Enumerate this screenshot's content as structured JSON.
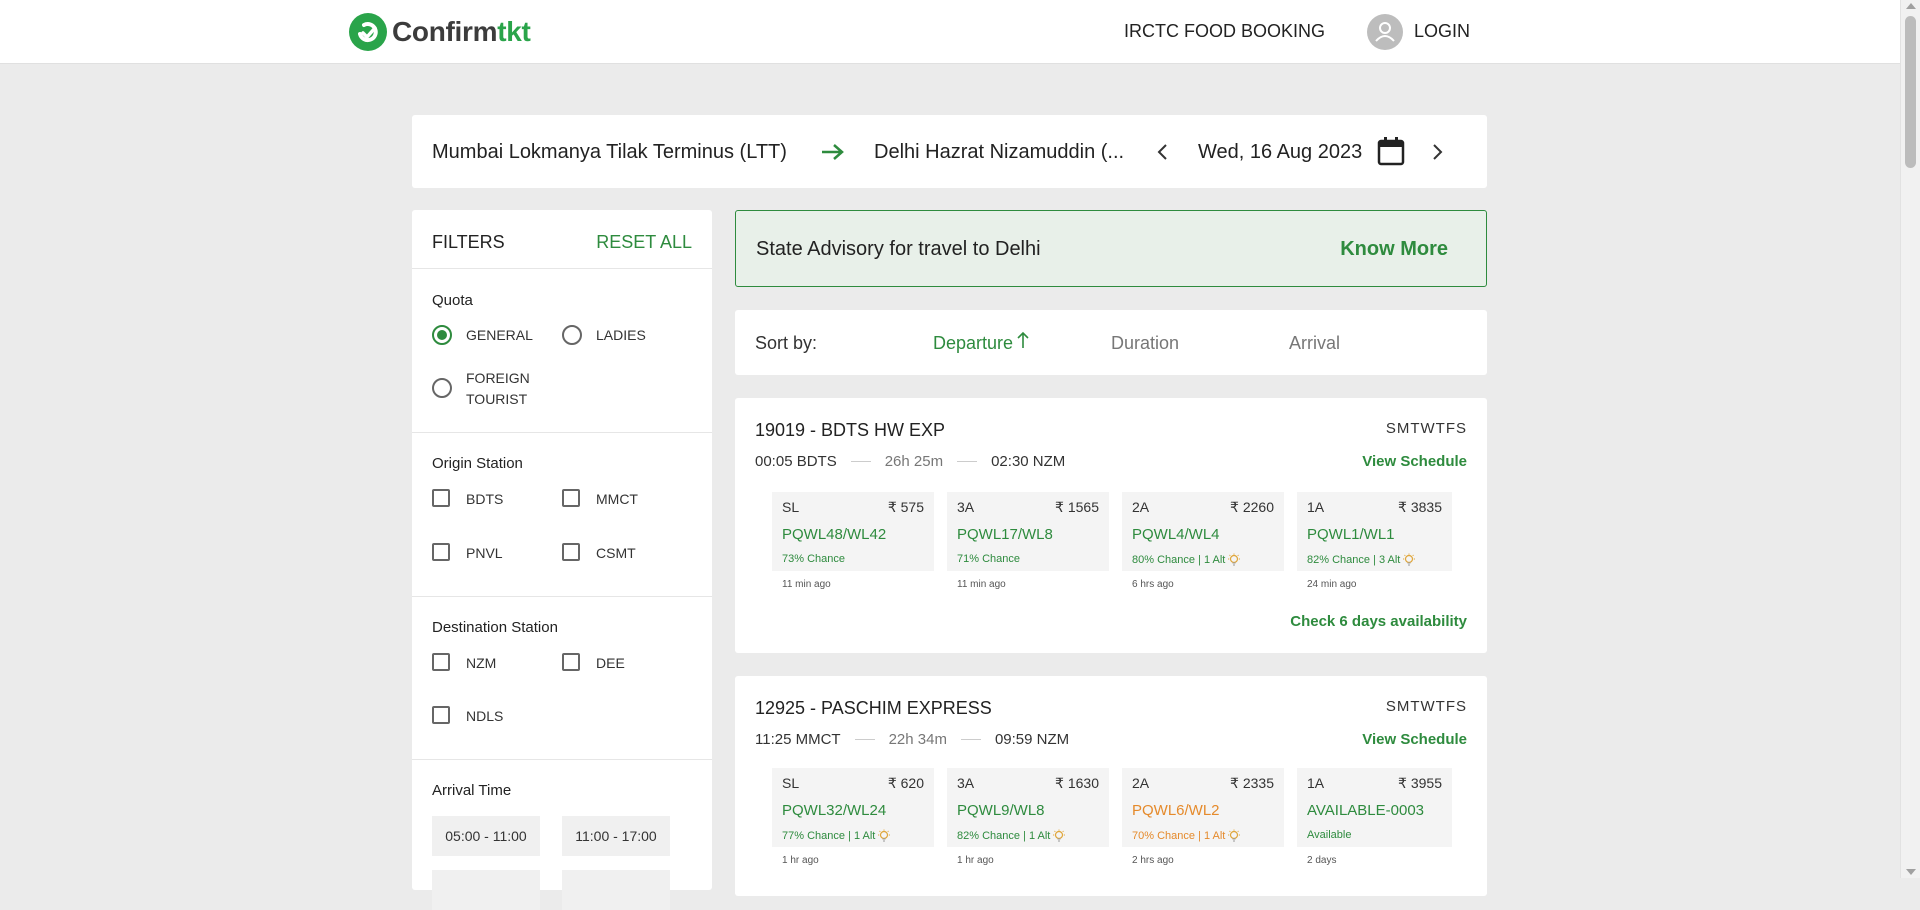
{
  "header": {
    "logo_part1": "Confirm",
    "logo_part2": "tkt",
    "food_booking": "IRCTC FOOD BOOKING",
    "login": "LOGIN"
  },
  "search": {
    "from": "Mumbai Lokmanya Tilak Terminus (LTT)",
    "to": "Delhi Hazrat Nizamuddin (...",
    "date": "Wed, 16 Aug 2023"
  },
  "filters": {
    "title": "FILTERS",
    "reset": "RESET ALL",
    "quota_title": "Quota",
    "quota_options": [
      "GENERAL",
      "LADIES",
      "FOREIGN",
      "TOURIST"
    ],
    "quota_selected": "GENERAL",
    "origin_title": "Origin Station",
    "origin_options": [
      "BDTS",
      "MMCT",
      "PNVL",
      "CSMT"
    ],
    "dest_title": "Destination Station",
    "dest_options": [
      "NZM",
      "DEE",
      "NDLS"
    ],
    "arrival_title": "Arrival Time",
    "arrival_slots": [
      "05:00 - 11:00",
      "11:00 - 17:00"
    ]
  },
  "advisory": {
    "text": "State Advisory for travel to Delhi",
    "link": "Know More"
  },
  "sort": {
    "label": "Sort by:",
    "options": [
      "Departure",
      "Duration",
      "Arrival"
    ],
    "active": "Departure"
  },
  "trains": [
    {
      "name": "19019 - BDTS HW EXP",
      "days": "SMTWTFS",
      "dep": "00:05 BDTS",
      "duration": "26h 25m",
      "arr": "02:30 NZM",
      "schedule_link": "View Schedule",
      "classes": [
        {
          "cls": "SL",
          "fare": "₹ 575",
          "status": "PQWL48/WL42",
          "chance": "73% Chance",
          "updated": "11 min ago",
          "tone": "green"
        },
        {
          "cls": "3A",
          "fare": "₹ 1565",
          "status": "PQWL17/WL8",
          "chance": "71% Chance",
          "updated": "11 min ago",
          "tone": "green"
        },
        {
          "cls": "2A",
          "fare": "₹ 2260",
          "status": "PQWL4/WL4",
          "chance": "80% Chance | 1 Alt",
          "updated": "6 hrs ago",
          "tone": "green"
        },
        {
          "cls": "1A",
          "fare": "₹ 3835",
          "status": "PQWL1/WL1",
          "chance": "82% Chance | 3 Alt",
          "updated": "24 min ago",
          "tone": "green"
        }
      ],
      "check_days": "Check 6 days availability"
    },
    {
      "name": "12925 - PASCHIM EXPRESS",
      "days": "SMTWTFS",
      "dep": "11:25 MMCT",
      "duration": "22h 34m",
      "arr": "09:59 NZM",
      "schedule_link": "View Schedule",
      "classes": [
        {
          "cls": "SL",
          "fare": "₹ 620",
          "status": "PQWL32/WL24",
          "chance": "77% Chance | 1 Alt",
          "updated": "1 hr ago",
          "tone": "green"
        },
        {
          "cls": "3A",
          "fare": "₹ 1630",
          "status": "PQWL9/WL8",
          "chance": "82% Chance | 1 Alt",
          "updated": "1 hr ago",
          "tone": "green"
        },
        {
          "cls": "2A",
          "fare": "₹ 2335",
          "status": "PQWL6/WL2",
          "chance": "70% Chance | 1 Alt",
          "updated": "2 hrs ago",
          "tone": "orange"
        },
        {
          "cls": "1A",
          "fare": "₹ 3955",
          "status": "AVAILABLE-0003",
          "chance": "Available",
          "updated": "2 days",
          "tone": "green"
        }
      ]
    }
  ],
  "colors": {
    "brand_green": "#2e8b3e",
    "logo_green": "#2aa44a",
    "orange": "#e58a2b",
    "page_bg": "#ebebeb"
  }
}
